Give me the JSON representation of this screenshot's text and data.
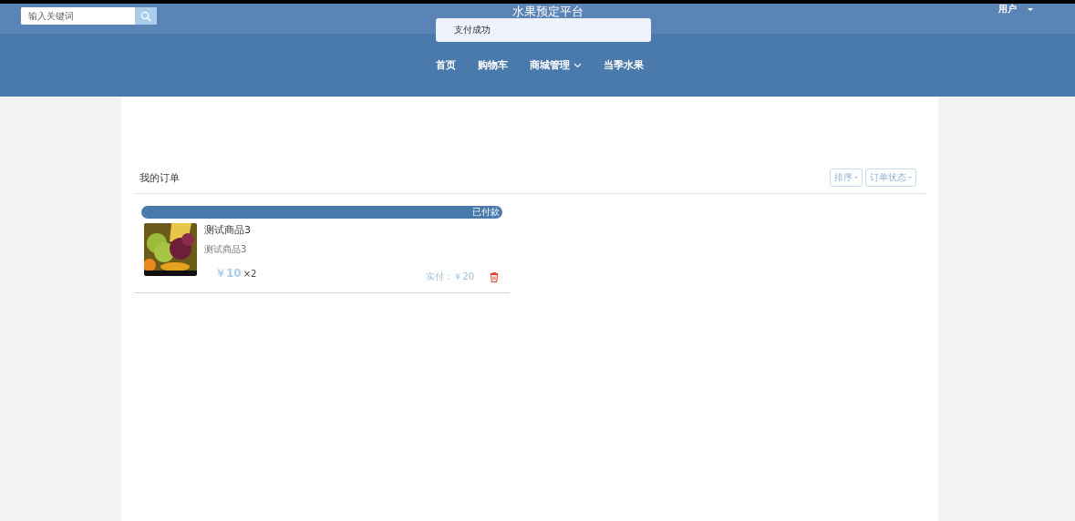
{
  "header": {
    "search": {
      "placeholder": "输入关键词"
    },
    "title": "水果预定平台",
    "user": "用户"
  },
  "toast": {
    "message": "支付成功"
  },
  "nav": [
    {
      "label": "首页",
      "dropdown": false
    },
    {
      "label": "购物车",
      "dropdown": false
    },
    {
      "label": "商城管理",
      "dropdown": true
    },
    {
      "label": "当季水果",
      "dropdown": false
    }
  ],
  "orders_panel": {
    "title": "我的订单",
    "filters": [
      "排序",
      "订单状态"
    ],
    "orders": [
      {
        "status": "已付款",
        "name": "测试商品3",
        "description": "测试商品3",
        "price": "￥10",
        "quantity": "×2",
        "total": "实付：￥20"
      }
    ]
  }
}
